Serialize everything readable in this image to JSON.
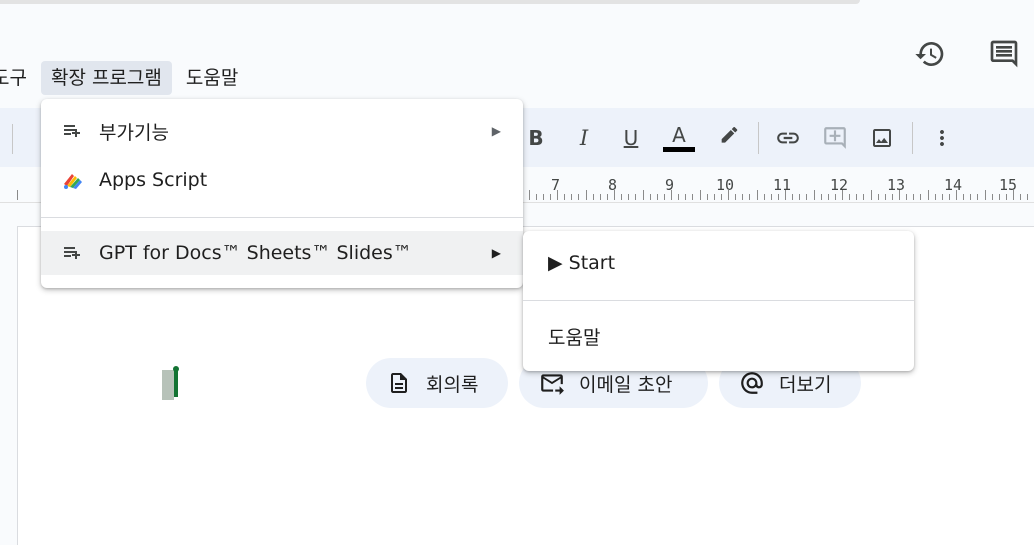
{
  "top_icons": {
    "history": "history-icon",
    "comments": "comment-icon"
  },
  "menubar": {
    "tools": "도구",
    "extensions": "확장 프로그램",
    "help": "도움말"
  },
  "ruler": {
    "numbers": [
      "7",
      "8",
      "9",
      "10",
      "11",
      "12",
      "13",
      "14",
      "15"
    ]
  },
  "extensions_menu": {
    "addons": "부가기능",
    "apps_script": "Apps Script",
    "gpt": "GPT for Docs™ Sheets™ Slides™"
  },
  "gpt_submenu": {
    "start": "▶ Start",
    "help": "도움말"
  },
  "chips": {
    "meeting_notes": "회의록",
    "email_draft": "이메일 초안",
    "more": "더보기"
  },
  "colors": {
    "accent_text_color_bar": "#000000",
    "cursor": "#137333",
    "toolbar_bg": "#edf2fa"
  }
}
